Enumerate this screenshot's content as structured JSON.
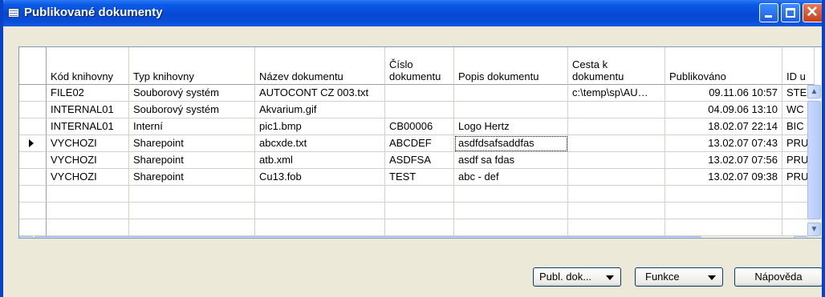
{
  "window": {
    "title": "Publikované dokumenty"
  },
  "columns": [
    {
      "key": "kod_knihovny",
      "label": "Kód knihovny"
    },
    {
      "key": "typ_knihovny",
      "label": "Typ knihovny"
    },
    {
      "key": "nazev_dokumentu",
      "label": "Název dokumentu"
    },
    {
      "key": "cislo_dokumentu",
      "label": "Číslo\ndokumentu"
    },
    {
      "key": "popis_dokumentu",
      "label": "Popis dokumentu"
    },
    {
      "key": "cesta_k_dokumentu",
      "label": "Cesta k\ndokumentu"
    },
    {
      "key": "publikovano",
      "label": "Publikováno"
    },
    {
      "key": "id",
      "label": "ID u"
    }
  ],
  "rows": [
    [
      "FILE02",
      "Souborový systém",
      "AUTOCONT CZ 003.txt",
      "",
      "",
      "c:\\temp\\sp\\AU…",
      "09.11.06 10:57",
      "STE"
    ],
    [
      "INTERNAL01",
      "Souborový systém",
      "Akvarium.gif",
      "",
      "",
      "",
      "04.09.06 13:10",
      "WC"
    ],
    [
      "INTERNAL01",
      "Interní",
      "pic1.bmp",
      "CB00006",
      "Logo Hertz",
      "",
      "18.02.07 22:14",
      "BIC"
    ],
    [
      "VYCHOZI",
      "Sharepoint",
      "abcxde.txt",
      "ABCDEF",
      "asdfdsafsaddfas",
      "",
      "13.02.07 07:43",
      "PRU"
    ],
    [
      "VYCHOZI",
      "Sharepoint",
      "atb.xml",
      "ASDFSA",
      "asdf sa fdas",
      "",
      "13.02.07 07:56",
      "PRU"
    ],
    [
      "VYCHOZI",
      "Sharepoint",
      "Cu13.fob",
      "TEST",
      "abc - def",
      "",
      "13.02.07 09:38",
      "PRU"
    ],
    [
      "",
      "",
      "",
      "",
      "",
      "",
      "",
      ""
    ],
    [
      "",
      "",
      "",
      "",
      "",
      "",
      "",
      ""
    ],
    [
      "",
      "",
      "",
      "",
      "",
      "",
      "",
      ""
    ]
  ],
  "buttons": {
    "publ_dok": "Publ. dok...",
    "funkce": "Funkce",
    "napoveda": "Nápověda"
  },
  "icons": {
    "window_icon": "table-icon",
    "minimize": "minimize-icon",
    "maximize": "maximize-icon",
    "close": "close-icon"
  }
}
